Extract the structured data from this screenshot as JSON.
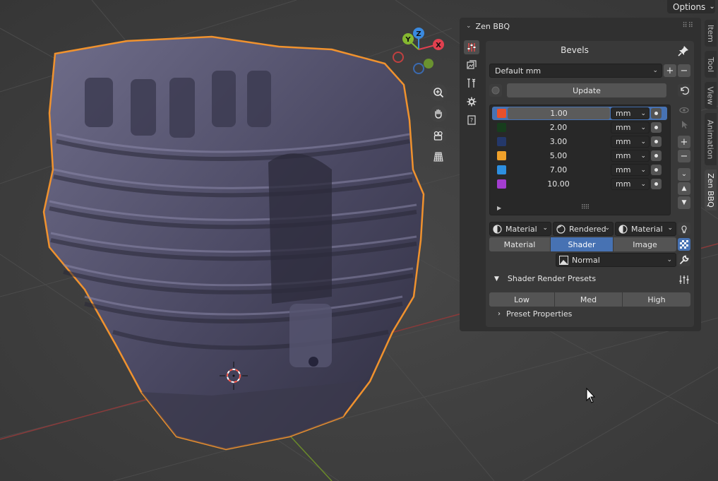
{
  "header": {
    "options_label": "Options"
  },
  "side_tabs": [
    "Item",
    "Tool",
    "View",
    "Animation",
    "Zen BBQ"
  ],
  "panel": {
    "title": "Zen BBQ",
    "section_title": "Bevels",
    "preset_value": "Default mm",
    "update_label": "Update",
    "bevels": [
      {
        "value": "1.00",
        "unit": "mm",
        "color": "#e8502b"
      },
      {
        "value": "2.00",
        "unit": "mm",
        "color": "#173d1d"
      },
      {
        "value": "3.00",
        "unit": "mm",
        "color": "#24386a"
      },
      {
        "value": "5.00",
        "unit": "mm",
        "color": "#f0a12a"
      },
      {
        "value": "7.00",
        "unit": "mm",
        "color": "#2d8fe0"
      },
      {
        "value": "10.00",
        "unit": "mm",
        "color": "#a43dd0"
      }
    ],
    "selected_bevel": "1.00",
    "shading": {
      "left": "Material",
      "mid": "Rendered",
      "right": "Material"
    },
    "mode_tabs": {
      "material": "Material",
      "shader": "Shader",
      "image": "Image",
      "active": "Shader"
    },
    "normal_value": "Normal",
    "render_presets": {
      "title": "Shader Render Presets",
      "low": "Low",
      "med": "Med",
      "high": "High"
    },
    "preset_properties_label": "Preset Properties"
  },
  "gizmo": {
    "x": "X",
    "y": "Y",
    "z": "Z"
  },
  "colors": {
    "accent": "#4772b3",
    "selection_outline": "#f0922e",
    "axis_x": "#e0404f",
    "axis_y": "#85b830",
    "axis_z": "#3a8ae0"
  }
}
